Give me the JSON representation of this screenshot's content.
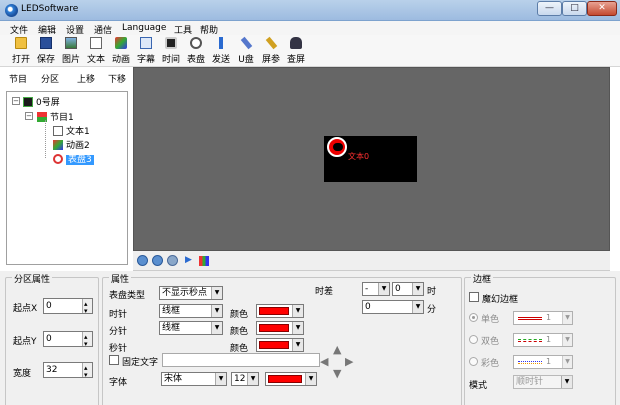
{
  "window": {
    "title": "LEDSoftware",
    "min": "—",
    "max": "□",
    "close": "✕"
  },
  "menu": [
    "文件",
    "编辑",
    "设置",
    "通信",
    "Language",
    "工具",
    "帮助"
  ],
  "toolbar": [
    {
      "label": "打开",
      "icon": "open-folder-icon"
    },
    {
      "label": "保存",
      "icon": "save-icon"
    },
    {
      "label": "图片",
      "icon": "picture-icon"
    },
    {
      "label": "文本",
      "icon": "text-icon"
    },
    {
      "label": "动画",
      "icon": "animation-icon"
    },
    {
      "label": "字幕",
      "icon": "subtitle-icon"
    },
    {
      "label": "时间",
      "icon": "time-icon"
    },
    {
      "label": "表盘",
      "icon": "clock-icon"
    },
    {
      "label": "发送",
      "icon": "send-icon"
    },
    {
      "label": "U盘",
      "icon": "usb-icon"
    },
    {
      "label": "屏参",
      "icon": "screen-params-icon"
    },
    {
      "label": "查屏",
      "icon": "find-screen-icon"
    }
  ],
  "sidebar": {
    "buttons": [
      "节目",
      "分区",
      "上移",
      "下移"
    ],
    "tree": {
      "screen": "0号屏",
      "program": "节目1",
      "items": [
        "文本1",
        "动画2",
        "表盘3"
      ]
    }
  },
  "preview": {
    "led_text": "文本0"
  },
  "area_props": {
    "title": "分区属性",
    "x_label": "起点X",
    "x_value": "0",
    "y_label": "起点Y",
    "y_value": "0",
    "w_label": "宽度",
    "w_value": "32"
  },
  "props": {
    "title": "属性",
    "dial_type_label": "表盘类型",
    "dial_type_value": "不显示秒点",
    "hour_label": "时针",
    "hour_style": "线框",
    "minute_label": "分针",
    "minute_style": "线框",
    "second_label": "秒针",
    "color_label": "颜色",
    "fixed_text_label": "固定文字",
    "font_label": "字体",
    "font_value": "宋体",
    "font_size": "12",
    "timediff_label": "时差",
    "timediff_sign": "-",
    "timediff_hour": "0",
    "hour_unit": "时",
    "timediff_minute": "0",
    "minute_unit": "分",
    "primary_color": "#ff0000"
  },
  "border": {
    "title": "边框",
    "magic_label": "魔幻边框",
    "single_label": "单色",
    "single_value": "1",
    "double_label": "双色",
    "double_value": "1",
    "multi_label": "彩色",
    "multi_value": "1",
    "mode_label": "模式",
    "mode_value": "顺时针"
  }
}
